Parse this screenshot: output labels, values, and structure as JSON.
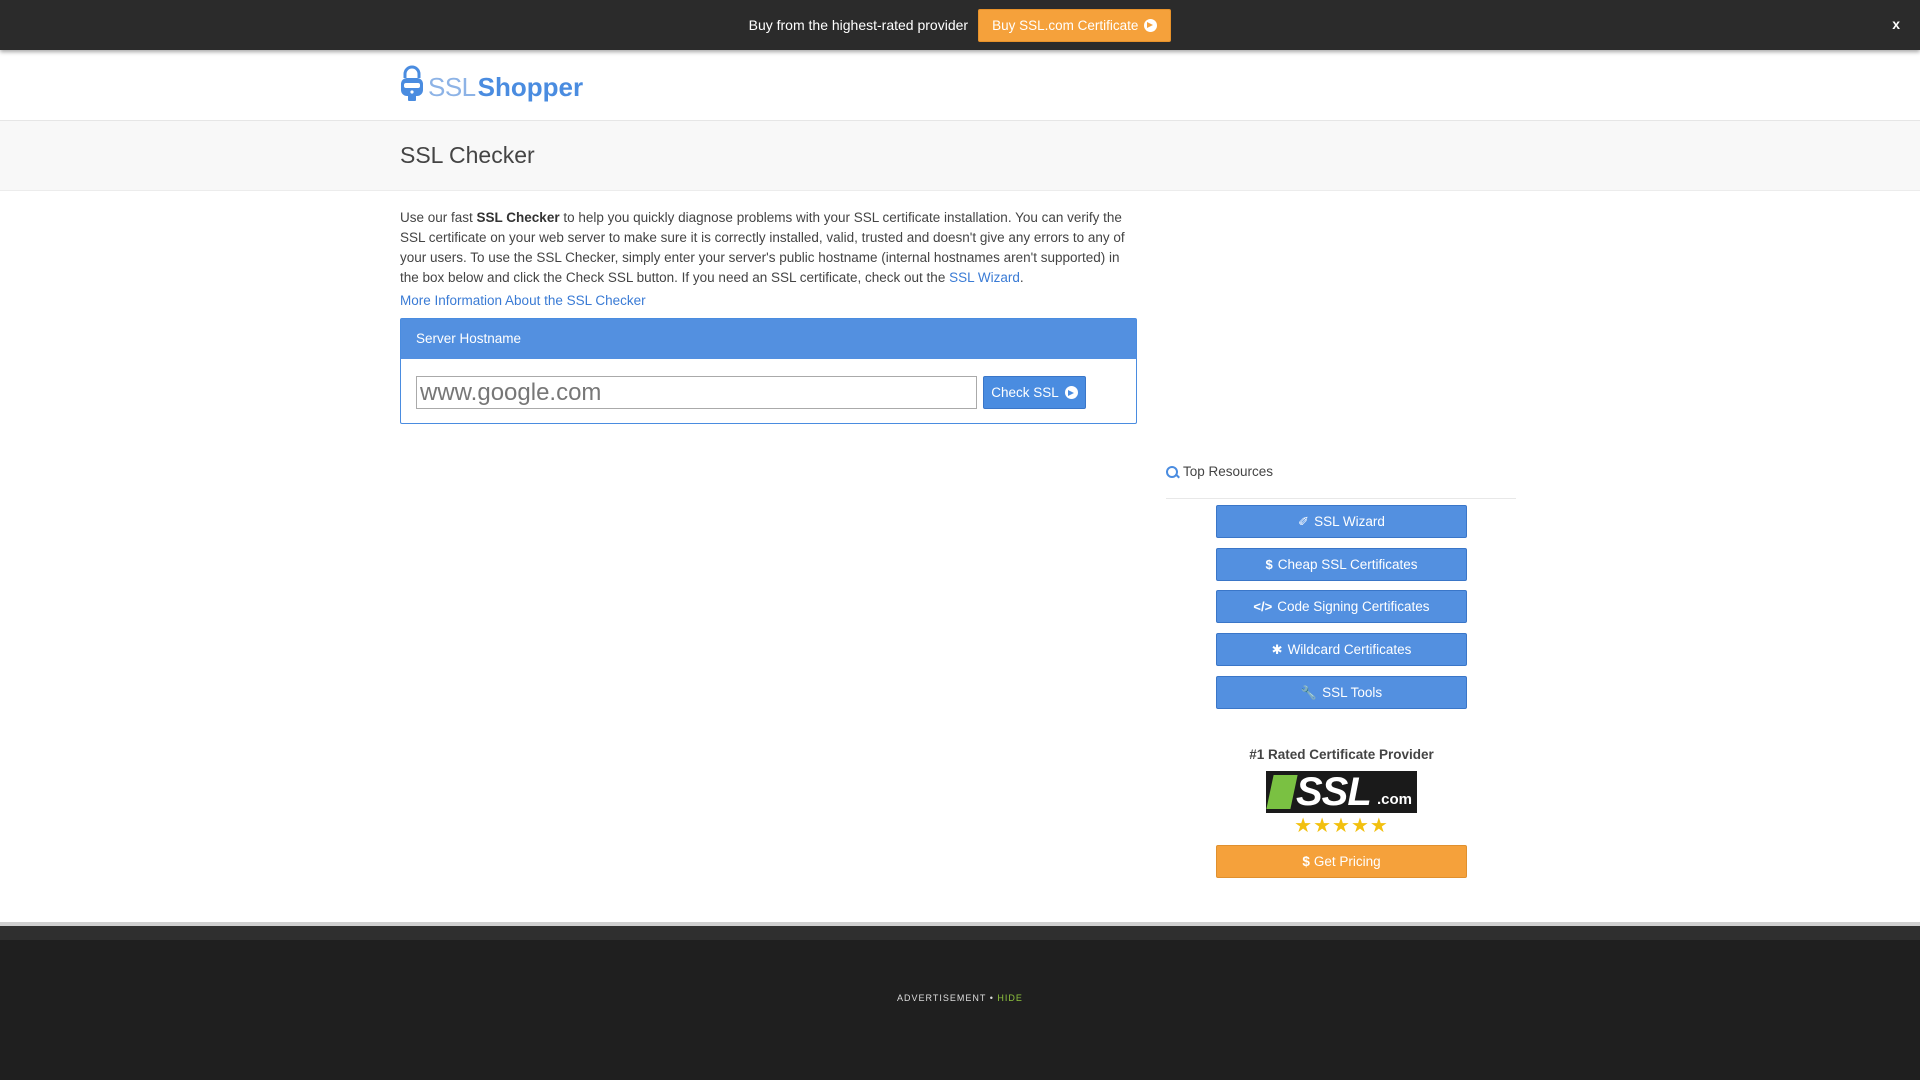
{
  "promo": {
    "text": "Buy from the highest-rated provider",
    "button_label": "Buy SSL.com Certificate",
    "close_label": "x"
  },
  "header": {
    "logo_ssl": "SSL",
    "logo_shopper": "Shopper"
  },
  "page": {
    "title": "SSL Checker"
  },
  "intro": {
    "part1": "Use our fast ",
    "bold": "SSL Checker",
    "part2": " to help you quickly diagnose problems with your SSL certificate installation. You can verify the SSL certificate on your web server to make sure it is correctly installed, valid, trusted and doesn't give any errors to any of your users. To use the SSL Checker, simply enter your server's public hostname (internal hostnames aren't supported) in the box below and click the Check SSL button. If you need an SSL certificate, check out the ",
    "wizard_link": "SSL Wizard",
    "part3": ".",
    "more_info_link": "More Information About the SSL Checker"
  },
  "checker": {
    "panel_title": "Server Hostname",
    "input_value": "www.google.com",
    "button_label": "Check SSL"
  },
  "sidebar": {
    "heading": "Top Resources",
    "buttons": [
      {
        "glyph": "✐",
        "label": "SSL Wizard",
        "icon": "magic-wand-icon"
      },
      {
        "glyph": "$",
        "label": "Cheap SSL Certificates",
        "icon": "dollar-icon"
      },
      {
        "glyph": "</>",
        "label": "Code Signing Certificates",
        "icon": "code-icon"
      },
      {
        "glyph": "✱",
        "label": "Wildcard Certificates",
        "icon": "asterisk-icon"
      },
      {
        "glyph": "🔧",
        "label": "SSL Tools",
        "icon": "wrench-icon"
      }
    ],
    "rated_title": "#1 Rated Certificate Provider",
    "brand_text": "SSL",
    "brand_suffix": ".com",
    "stars": "★★★★★",
    "rating_stars": 5,
    "pricing_glyph": "$",
    "pricing_label": "Get Pricing"
  },
  "footer": {
    "ad_label": "ADVERTISEMENT",
    "separator": "•",
    "hide_label": "HIDE"
  },
  "colors": {
    "accent_blue": "#5390e0",
    "accent_orange": "#f5a13b",
    "promo_bg": "#2b2b2b",
    "footer_bg": "#1f1f1f"
  }
}
